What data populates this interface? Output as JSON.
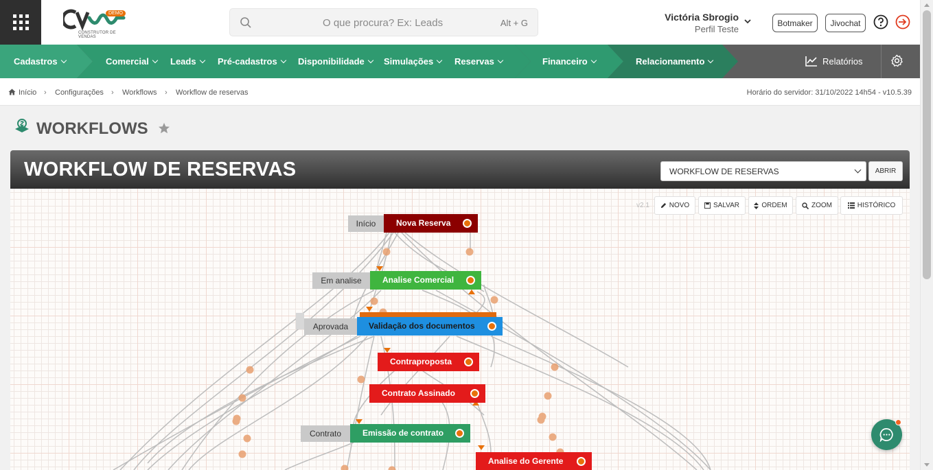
{
  "header": {
    "logo_badge": "DEMO",
    "logo_subtitle": "CONSTRUTOR DE VENDAS",
    "search_placeholder": "O que procura? Ex: Leads",
    "search_shortcut": "Alt + G",
    "user_name": "Victória Sbrogio",
    "user_role": "Perfil Teste",
    "botmaker_label": "Botmaker",
    "jivochat_label": "Jivochat"
  },
  "nav": {
    "items": [
      "Cadastros",
      "Comercial",
      "Leads",
      "Pré-cadastros",
      "Disponibilidade",
      "Simulações",
      "Reservas",
      "Financeiro",
      "Relacionamento"
    ],
    "reports_label": "Relatórios",
    "colors": {
      "green_light": "#3aa57c",
      "green_mid": "#2f9a70",
      "green_dark": "#2b7f5e",
      "gray": "#5e5e5e"
    }
  },
  "breadcrumb": {
    "items": [
      "Início",
      "Configurações",
      "Workflows",
      "Workflow de reservas"
    ],
    "server_time": "Horário do servidor: 31/10/2022 14h54 - v10.5.39"
  },
  "page": {
    "title": "WORKFLOWS"
  },
  "panel": {
    "title": "WORKFLOW DE RESERVAS",
    "select_value": "WORKFLOW DE RESERVAS",
    "open_button": "ABRIR"
  },
  "toolbar": {
    "version": "v2.1",
    "buttons": [
      "NOVO",
      "SALVAR",
      "ORDEM",
      "ZOOM",
      "HISTÓRICO"
    ]
  },
  "workflow_nodes": [
    {
      "label": "Início",
      "name": "Nova Reserva",
      "color": "#8b0000"
    },
    {
      "label": "Em analise",
      "name": "Analise Comercial",
      "color": "#3fb53f"
    },
    {
      "label": "Aprovada",
      "name": "Validação dos documentos",
      "color": "#1e8fe0"
    },
    {
      "label": "",
      "name": "Contraproposta",
      "color": "#e31b1b"
    },
    {
      "label": "",
      "name": "Contrato Assinado",
      "color": "#e31b1b"
    },
    {
      "label": "Contrato",
      "name": "Emissão de contrato",
      "color": "#2e9e63"
    },
    {
      "label": "",
      "name": "Analise do Gerente",
      "color": "#e31b1b"
    }
  ],
  "accent_color": "#e8710a"
}
